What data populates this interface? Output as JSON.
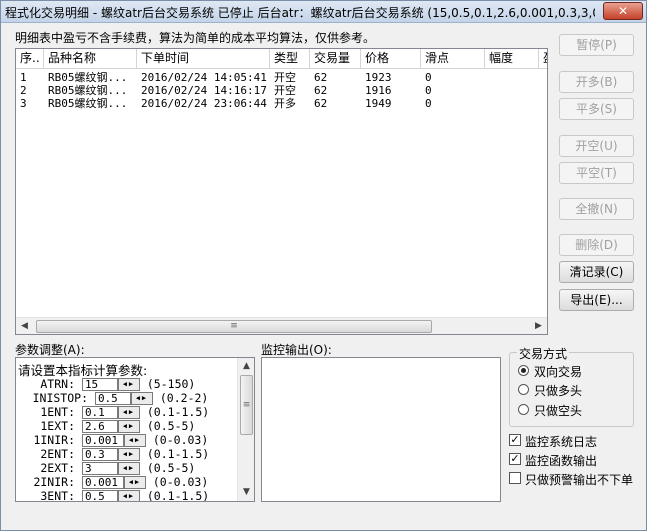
{
  "window": {
    "title": "程式化交易明细 - 螺纹atr后台交易系统 已停止  后台atr：螺纹atr后台交易系统 (15,0.5,0.1,2.6,0.001,0.3,3,0...",
    "close_label": "✕"
  },
  "note": "明细表中盈亏不含手续费，算法为简单的成本平均算法，仅供参考。",
  "table": {
    "columns": [
      "序..",
      "品种名称",
      "下单时间",
      "类型",
      "交易量",
      "价格",
      "滑点",
      "幅度",
      "盈"
    ],
    "rows": [
      {
        "seq": "1",
        "name": "RB05螺纹钢...",
        "time": "2016/02/24 14:05:41",
        "type": "开空",
        "qty": "62",
        "price": "1923",
        "slip": "0",
        "range": ""
      },
      {
        "seq": "2",
        "name": "RB05螺纹钢...",
        "time": "2016/02/24 14:16:17",
        "type": "开空",
        "qty": "62",
        "price": "1916",
        "slip": "0",
        "range": ""
      },
      {
        "seq": "3",
        "name": "RB05螺纹钢...",
        "time": "2016/02/24 23:06:44",
        "type": "开多",
        "qty": "62",
        "price": "1949",
        "slip": "0",
        "range": ""
      }
    ]
  },
  "buttons": {
    "pause": "暂停(P)",
    "open_long": "开多(B)",
    "close_long": "平多(S)",
    "open_short": "开空(U)",
    "close_short": "平空(T)",
    "cancel_all": "全撤(N)",
    "delete": "删除(D)",
    "clear_log": "清记录(C)",
    "export": "导出(E)..."
  },
  "params": {
    "label": "参数调整(A):",
    "heading": "请设置本指标计算参数:",
    "items": [
      {
        "name": "ATRN:",
        "value": "15",
        "range": "(5-150)"
      },
      {
        "name": "INISTOP:",
        "value": "0.5",
        "range": "(0.2-2)"
      },
      {
        "name": "1ENT:",
        "value": "0.1",
        "range": "(0.1-1.5)"
      },
      {
        "name": "1EXT:",
        "value": "2.6",
        "range": "(0.5-5)"
      },
      {
        "name": "1INIR:",
        "value": "0.001",
        "range": "(0-0.03)"
      },
      {
        "name": "2ENT:",
        "value": "0.3",
        "range": "(0.1-1.5)"
      },
      {
        "name": "2EXT:",
        "value": "3",
        "range": "(0.5-5)"
      },
      {
        "name": "2INIR:",
        "value": "0.001",
        "range": "(0-0.03)"
      },
      {
        "name": "3ENT:",
        "value": "0.5",
        "range": "(0.1-1.5)"
      }
    ]
  },
  "monitor": {
    "label": "监控输出(O):"
  },
  "trade_mode": {
    "title": "交易方式",
    "options": [
      "双向交易",
      "只做多头",
      "只做空头"
    ],
    "selected": 0
  },
  "checkboxes": {
    "log": "监控系统日志",
    "func_output": "监控函数输出",
    "warn_only": "只做预警输出不下单"
  },
  "checkbox_states": {
    "log": true,
    "func_output": true,
    "warn_only": false
  }
}
